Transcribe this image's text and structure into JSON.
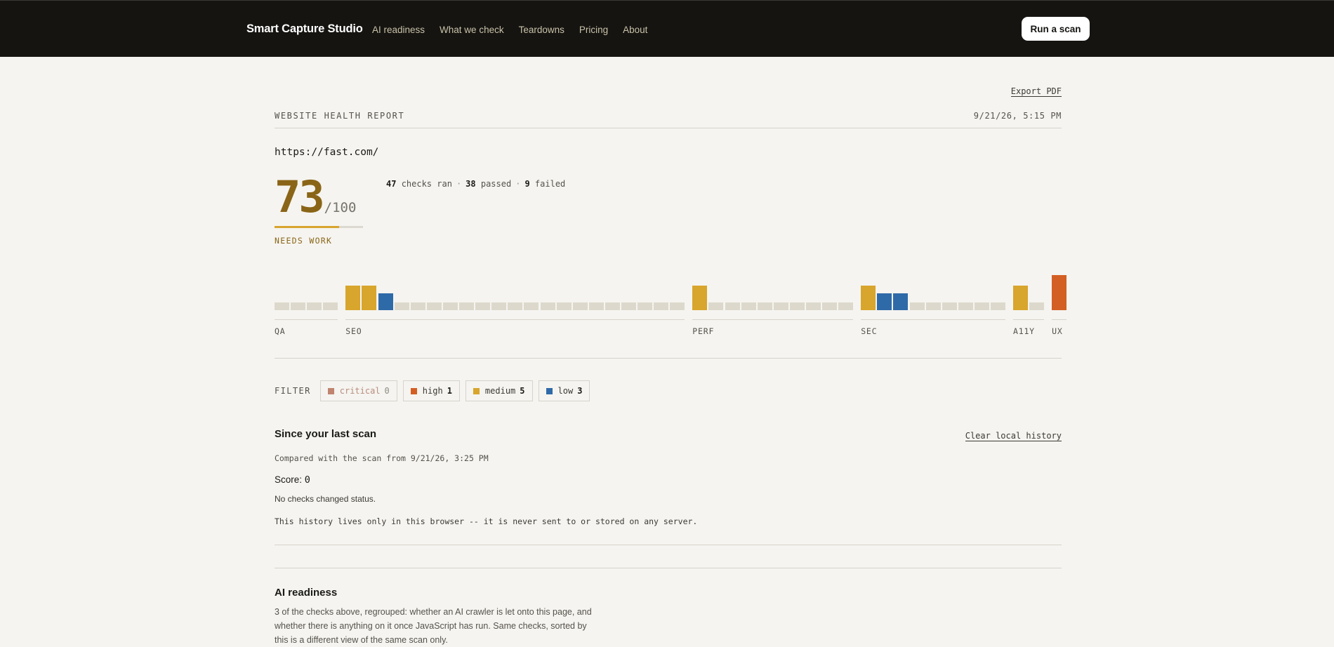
{
  "header": {
    "brand": "Smart Capture Studio",
    "nav": [
      "AI readiness",
      "What we check",
      "Teardowns",
      "Pricing",
      "About"
    ],
    "cta": "Run a scan"
  },
  "report": {
    "export_label": "Export PDF",
    "title": "WEBSITE HEALTH REPORT",
    "date": "9/21/26, 5:15 PM",
    "url": "https://fast.com/",
    "score": "73",
    "score_max": "/100",
    "score_fraction": 0.73,
    "status": "NEEDS WORK",
    "counts": {
      "ran": "47",
      "ran_label": "checks ran",
      "passed": "38",
      "passed_label": "passed",
      "failed": "9",
      "failed_label": "failed",
      "sep": "·"
    }
  },
  "check_map": {
    "colors": {
      "pass": "#dcd9cc",
      "critical": "#c0846f",
      "high": "#d35f24",
      "medium": "#d8a52d",
      "low": "#2f6aa8"
    },
    "groups": [
      {
        "label": "QA",
        "checks": [
          "pass",
          "pass",
          "pass",
          "pass"
        ]
      },
      {
        "label": "SEO",
        "checks": [
          "medium",
          "medium",
          "low",
          "pass",
          "pass",
          "pass",
          "pass",
          "pass",
          "pass",
          "pass",
          "pass",
          "pass",
          "pass",
          "pass",
          "pass",
          "pass",
          "pass",
          "pass",
          "pass",
          "pass",
          "pass"
        ]
      },
      {
        "label": "PERF",
        "checks": [
          "medium",
          "pass",
          "pass",
          "pass",
          "pass",
          "pass",
          "pass",
          "pass",
          "pass",
          "pass"
        ]
      },
      {
        "label": "SEC",
        "checks": [
          "medium",
          "low",
          "low",
          "pass",
          "pass",
          "pass",
          "pass",
          "pass",
          "pass"
        ]
      },
      {
        "label": "A11Y",
        "checks": [
          "medium",
          "pass"
        ]
      },
      {
        "label": "UX",
        "checks": [
          "high"
        ]
      }
    ]
  },
  "filter": {
    "label": "FILTER",
    "chips": [
      {
        "name": "critical",
        "count": "0",
        "color": "#c0846f"
      },
      {
        "name": "high",
        "count": "1",
        "color": "#d35f24"
      },
      {
        "name": "medium",
        "count": "5",
        "color": "#d8a52d"
      },
      {
        "name": "low",
        "count": "3",
        "color": "#2f6aa8"
      }
    ]
  },
  "history": {
    "title": "Since your last scan",
    "clear_label": "Clear local history",
    "compared": "Compared with the scan from 9/21/26, 3:25 PM",
    "score_label": "Score:",
    "score_delta": "0",
    "no_change": "No checks changed status.",
    "privacy_note": "This history lives only in this browser -- it is never sent to or stored on any server."
  },
  "ai_readiness": {
    "title": "AI readiness",
    "description": "3 of the checks above, regrouped: whether an AI crawler is let onto this page, and whether there is anything on it once JavaScript has run. Same checks, sorted by this is a different view of the same scan only."
  }
}
